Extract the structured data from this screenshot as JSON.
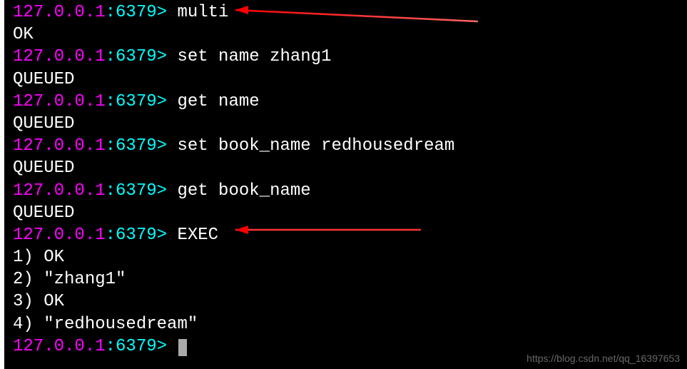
{
  "prompt": {
    "ip": "127.0.0.1",
    "port": ":6379>"
  },
  "lines": [
    {
      "type": "cmd",
      "command": "multi"
    },
    {
      "type": "out",
      "text": "OK"
    },
    {
      "type": "cmd",
      "command": "set name zhang1"
    },
    {
      "type": "out",
      "text": "QUEUED"
    },
    {
      "type": "cmd",
      "command": "get name"
    },
    {
      "type": "out",
      "text": "QUEUED"
    },
    {
      "type": "cmd",
      "command": "set book_name redhousedream"
    },
    {
      "type": "out",
      "text": "QUEUED"
    },
    {
      "type": "cmd",
      "command": "get book_name"
    },
    {
      "type": "out",
      "text": "QUEUED"
    },
    {
      "type": "cmd",
      "command": "EXEC"
    },
    {
      "type": "out",
      "text": "1) OK"
    },
    {
      "type": "out",
      "text": "2) \"zhang1\""
    },
    {
      "type": "out",
      "text": "3) OK"
    },
    {
      "type": "out",
      "text": "4) \"redhousedream\""
    },
    {
      "type": "cmd",
      "command": "",
      "cursor": true
    }
  ],
  "watermark": "https://blog.csdn.net/qq_16397653"
}
